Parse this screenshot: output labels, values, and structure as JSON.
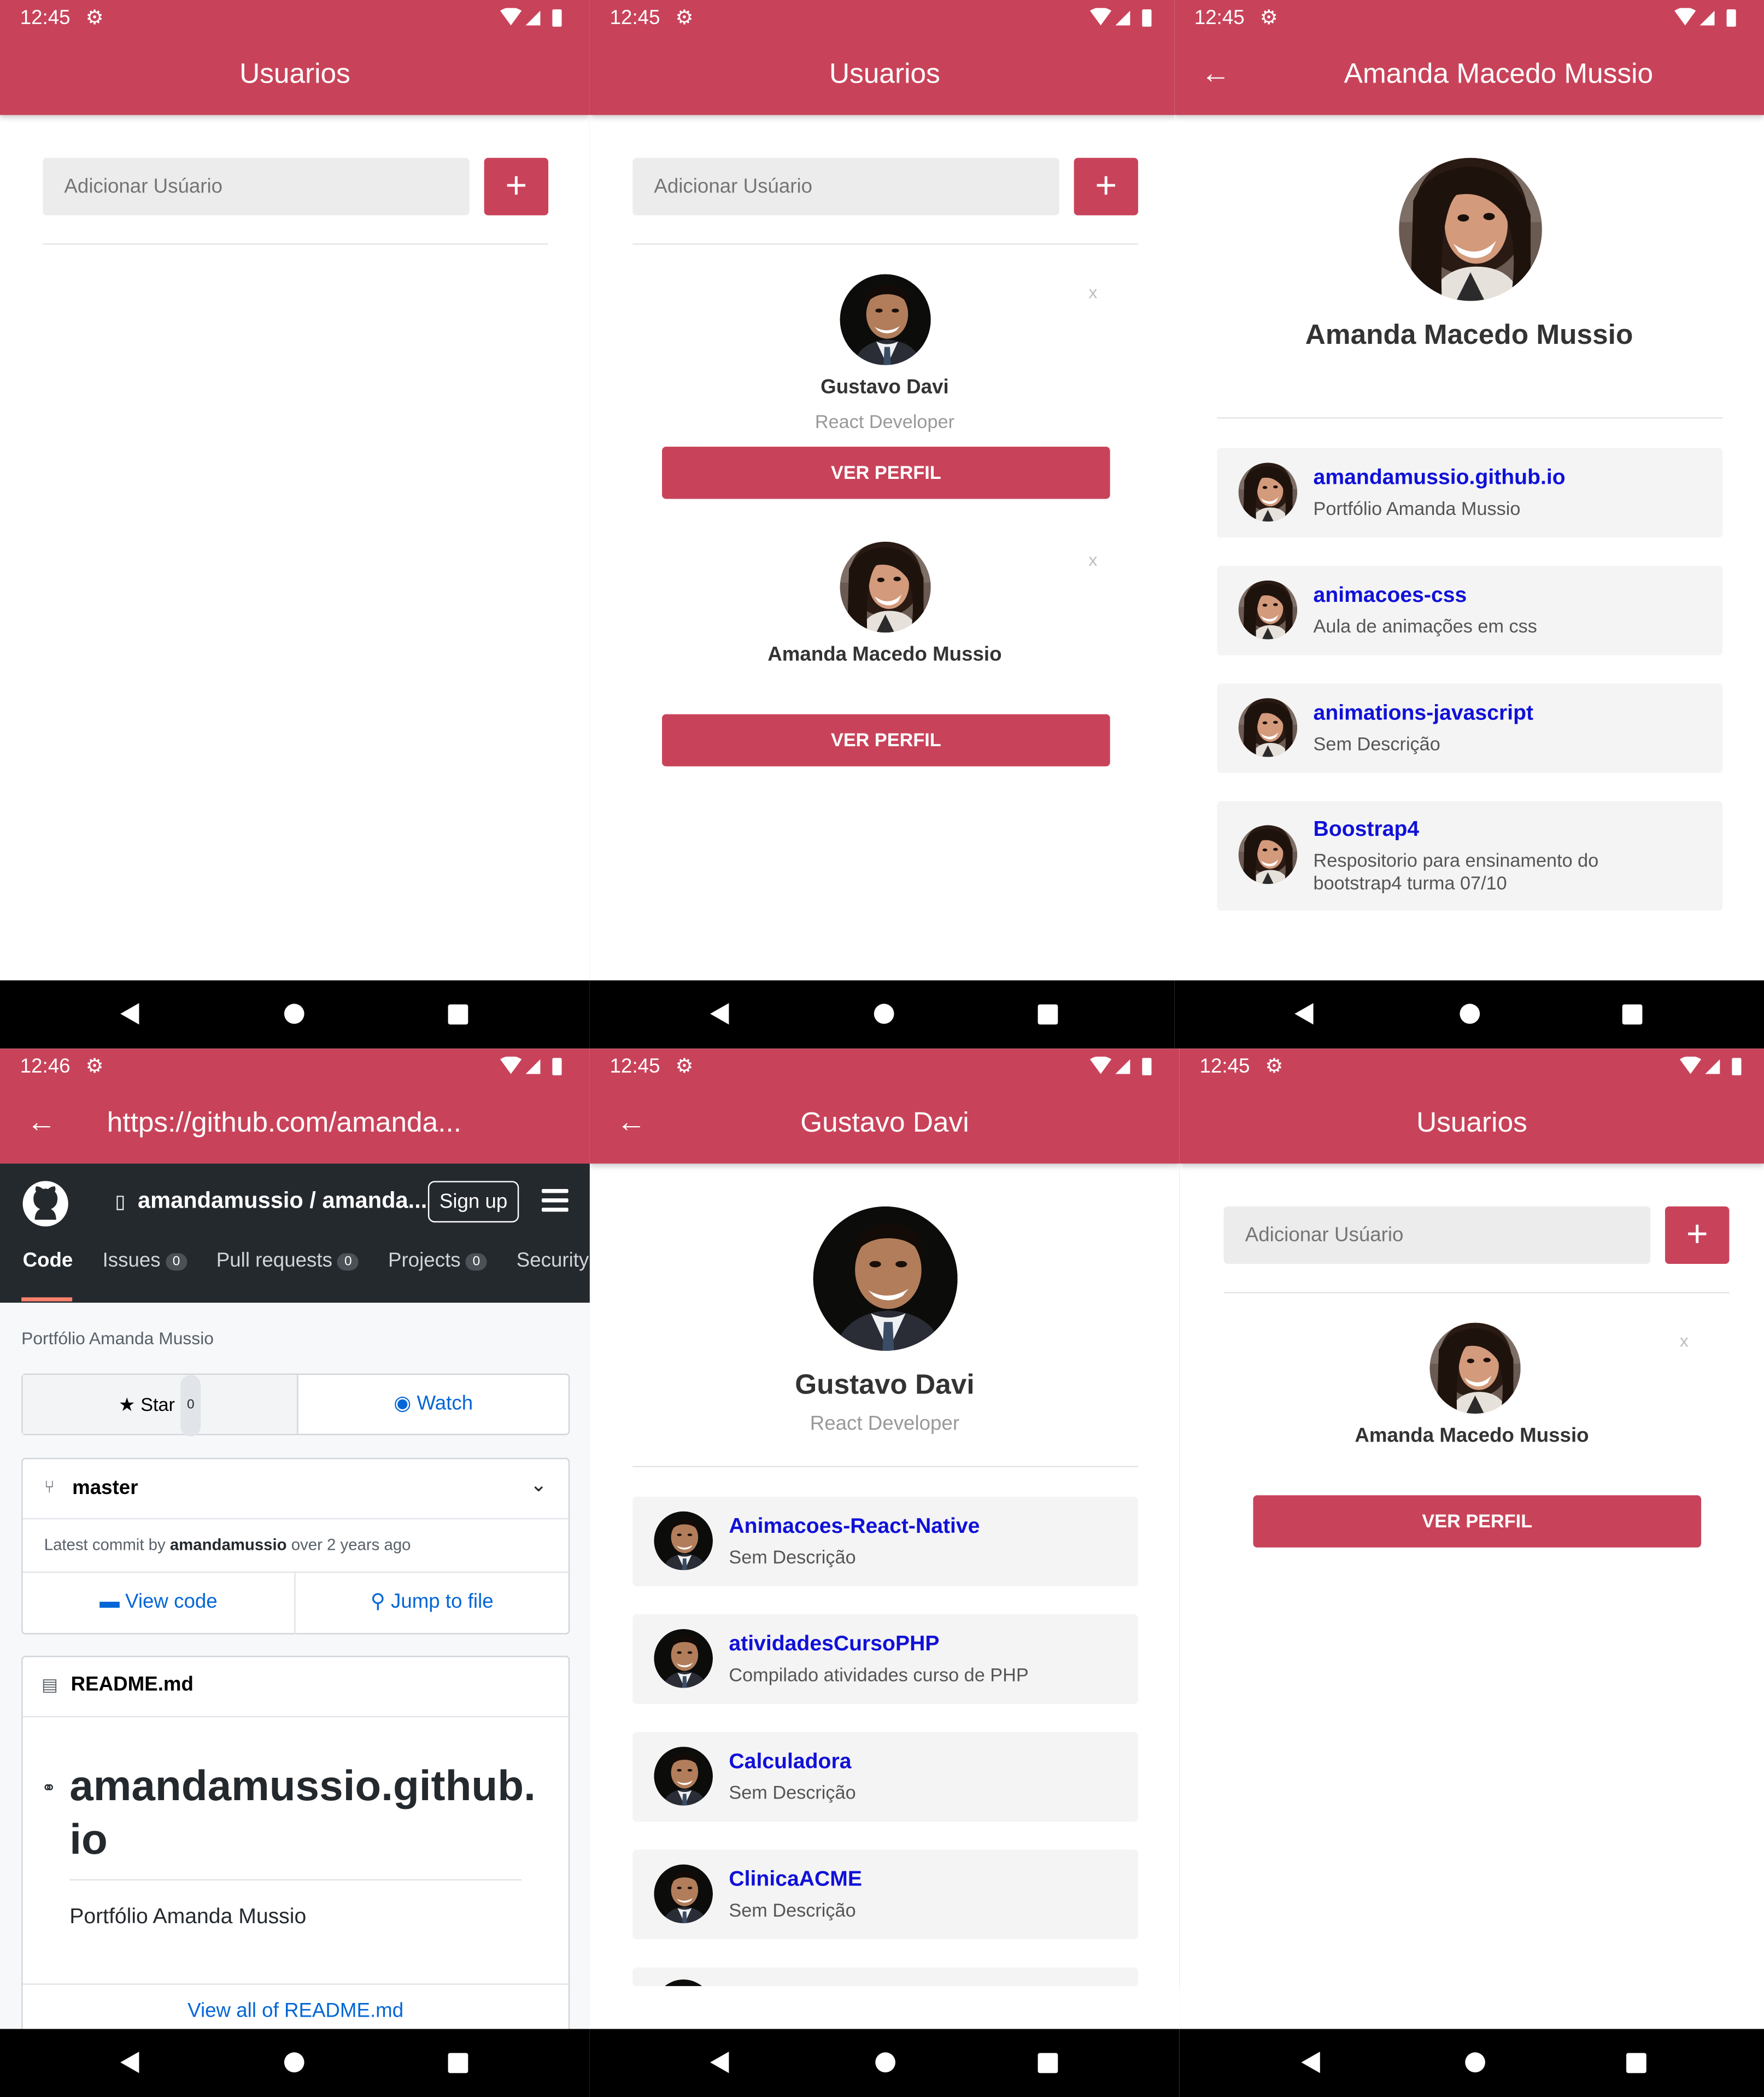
{
  "theme": {
    "accent": "#c8435a",
    "link": "#1010d8",
    "github_dark": "#24292e"
  },
  "screens": {
    "s1": {
      "time": "12:45",
      "title": "Usuarios",
      "add_placeholder": "Adicionar Usúario",
      "add_label": "+"
    },
    "s2": {
      "time": "12:45",
      "title": "Usuarios",
      "add_placeholder": "Adicionar Usúario",
      "add_label": "+",
      "users": [
        {
          "name": "Gustavo Davi",
          "bio": "React Developer",
          "button": "VER PERFIL",
          "remove": "x"
        },
        {
          "name": "Amanda Macedo Mussio",
          "bio": "",
          "button": "VER PERFIL",
          "remove": "x"
        }
      ]
    },
    "s3": {
      "time": "12:45",
      "title": "Amanda Macedo Mussio",
      "profile_name": "Amanda Macedo Mussio",
      "repos": [
        {
          "name": "amandamussio.github.io",
          "desc": "Portfólio Amanda Mussio"
        },
        {
          "name": "animacoes-css",
          "desc": "Aula de animações em css"
        },
        {
          "name": "animations-javascript",
          "desc": "Sem Descrição"
        },
        {
          "name": "Boostrap4",
          "desc": "Respositorio para ensinamento do bootstrap4 turma 07/10"
        }
      ]
    },
    "s4": {
      "time": "12:46",
      "title": "https://github.com/amanda...",
      "repo_path": "amandamussio / amanda...",
      "signup": "Sign up",
      "tabs": [
        {
          "label": "Code",
          "count": ""
        },
        {
          "label": "Issues",
          "count": "0"
        },
        {
          "label": "Pull requests",
          "count": "0"
        },
        {
          "label": "Projects",
          "count": "0"
        },
        {
          "label": "Security",
          "count": ""
        }
      ],
      "description": "Portfólio Amanda Mussio",
      "star": "Star",
      "star_count": "0",
      "watch": "Watch",
      "branch": "master",
      "commit_prefix": "Latest commit by",
      "commit_author": "amandamussio",
      "commit_time": "over 2 years ago",
      "view_code": "View code",
      "jump_to_file": "Jump to file",
      "readme_file": "README.md",
      "readme_title_1": "amandamussio.github.",
      "readme_title_2": "io",
      "readme_text": "Portfólio Amanda Mussio",
      "view_all": "View all of README.md"
    },
    "s5": {
      "time": "12:45",
      "title": "Gustavo Davi",
      "profile_name": "Gustavo Davi",
      "profile_bio": "React Developer",
      "repos": [
        {
          "name": "Animacoes-React-Native",
          "desc": "Sem Descrição"
        },
        {
          "name": "atividadesCursoPHP",
          "desc": "Compilado atividades curso de PHP"
        },
        {
          "name": "Calculadora",
          "desc": "Sem Descrição"
        },
        {
          "name": "ClinicaACME",
          "desc": "Sem Descrição"
        }
      ]
    },
    "s6": {
      "time": "12:45",
      "title": "Usuarios",
      "add_placeholder": "Adicionar Usúario",
      "add_label": "+",
      "users": [
        {
          "name": "Amanda Macedo Mussio",
          "button": "VER PERFIL",
          "remove": "x"
        }
      ]
    }
  }
}
